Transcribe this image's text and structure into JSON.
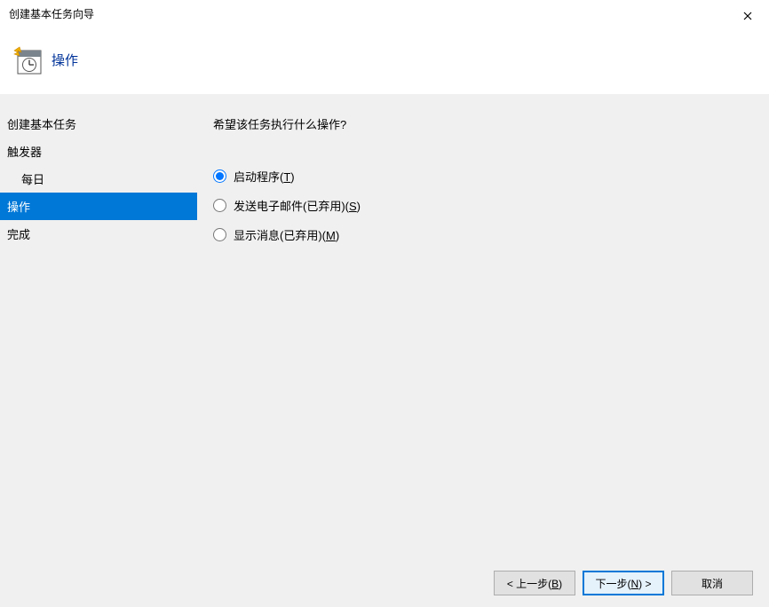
{
  "window": {
    "title": "创建基本任务向导"
  },
  "header": {
    "page_title": "操作"
  },
  "sidebar": {
    "items": [
      {
        "label": "创建基本任务",
        "indent": false,
        "active": false
      },
      {
        "label": "触发器",
        "indent": false,
        "active": false
      },
      {
        "label": "每日",
        "indent": true,
        "active": false
      },
      {
        "label": "操作",
        "indent": false,
        "active": true
      },
      {
        "label": "完成",
        "indent": false,
        "active": false
      }
    ]
  },
  "main": {
    "prompt": "希望该任务执行什么操作?",
    "options": [
      {
        "id": "start-program",
        "label_pre": "启动程序(",
        "accel": "T",
        "label_post": ")",
        "checked": true
      },
      {
        "id": "send-email",
        "label_pre": "发送电子邮件(已弃用)(",
        "accel": "S",
        "label_post": ")",
        "checked": false
      },
      {
        "id": "show-message",
        "label_pre": "显示消息(已弃用)(",
        "accel": "M",
        "label_post": ")",
        "checked": false
      }
    ]
  },
  "footer": {
    "back_pre": "< 上一步(",
    "back_accel": "B",
    "back_post": ")",
    "next_pre": "下一步(",
    "next_accel": "N",
    "next_post": ") >",
    "cancel": "取消"
  }
}
